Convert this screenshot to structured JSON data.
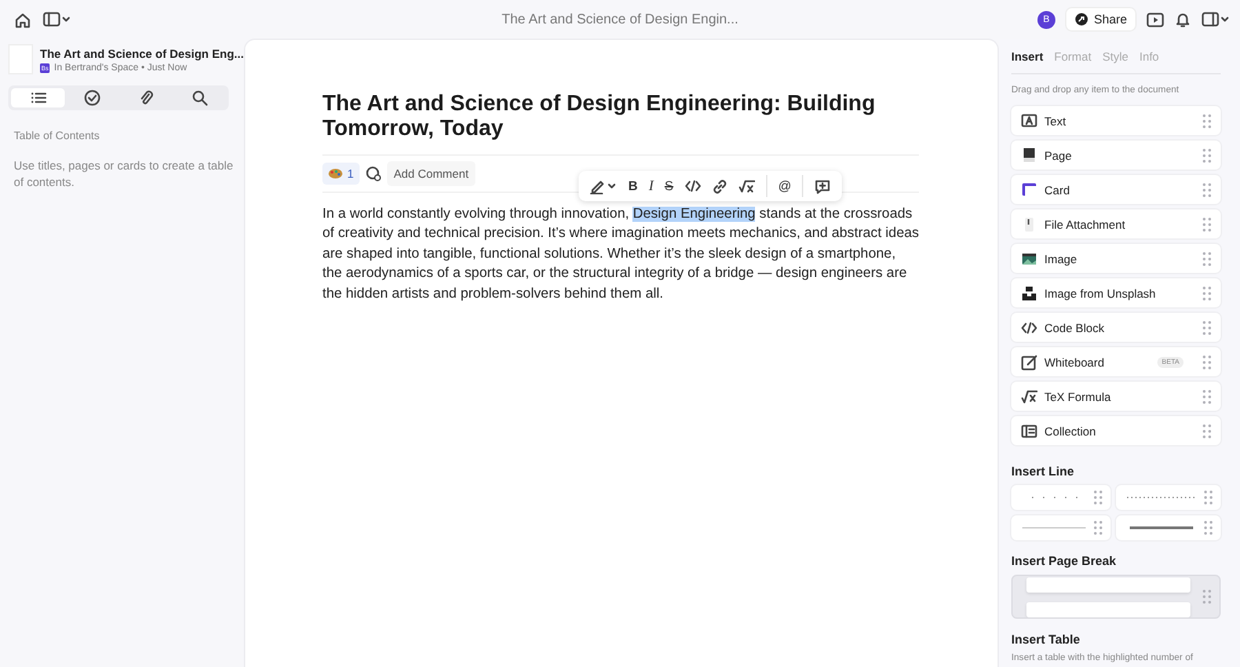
{
  "window": {
    "title": "The Art and Science of Design Engin..."
  },
  "topbar": {
    "avatar": "B",
    "share": "Share"
  },
  "sidebar": {
    "doc_title": "The Art and Science of Design Eng...",
    "space_badge": "Bs",
    "location": "In Bertrand's Space • Just Now",
    "tabs": [
      {
        "kind": "toc",
        "selected": true
      },
      {
        "kind": "tasks",
        "selected": false
      },
      {
        "kind": "attachments",
        "selected": false
      },
      {
        "kind": "search",
        "selected": false
      }
    ],
    "toc_heading": "Table of Contents",
    "toc_hint": "Use titles, pages or cards to create a table of contents."
  },
  "document": {
    "title": "The Art and Science of Design Engineering: Building Tomorrow, Today",
    "reaction_count": "1",
    "add_comment": "Add Comment",
    "format_toolbar": {
      "bold": "B",
      "italic": "I",
      "strike": "S",
      "mention": "@"
    },
    "paragraph_before": "In a world constantly evolving through innovation, ",
    "selection": "Design Engineering",
    "paragraph_after": " stands at the crossroads of creativity and technical precision. It’s where imagination meets mechanics, and abstract ideas are shaped into tangible, functional solutions. Whether it’s the sleek design of a smartphone, the aerodynamics of a sports car, or the structural integrity of a bridge — design engineers are the hidden artists and problem-solvers behind them all."
  },
  "panel": {
    "tabs": [
      {
        "label": "Insert",
        "selected": true
      },
      {
        "label": "Format",
        "selected": false
      },
      {
        "label": "Style",
        "selected": false
      },
      {
        "label": "Info",
        "selected": false
      }
    ],
    "hint": "Drag and drop any item to the document",
    "items": [
      {
        "kind": "text",
        "label": "Text"
      },
      {
        "kind": "page",
        "label": "Page"
      },
      {
        "kind": "card",
        "label": "Card"
      },
      {
        "kind": "file",
        "label": "File Attachment"
      },
      {
        "kind": "image",
        "label": "Image"
      },
      {
        "kind": "unsplash",
        "label": "Image from Unsplash"
      },
      {
        "kind": "code",
        "label": "Code Block"
      },
      {
        "kind": "whiteboard",
        "label": "Whiteboard",
        "badge": "BETA"
      },
      {
        "kind": "tex",
        "label": "TeX Formula"
      },
      {
        "kind": "collection",
        "label": "Collection"
      }
    ],
    "line_heading": "Insert Line",
    "lines": [
      {
        "kind": "sparse"
      },
      {
        "kind": "dotted"
      },
      {
        "kind": "thin"
      },
      {
        "kind": "thick"
      }
    ],
    "page_break_heading": "Insert Page Break",
    "table_heading": "Insert Table",
    "table_hint": "Insert a table with the highlighted number of"
  }
}
